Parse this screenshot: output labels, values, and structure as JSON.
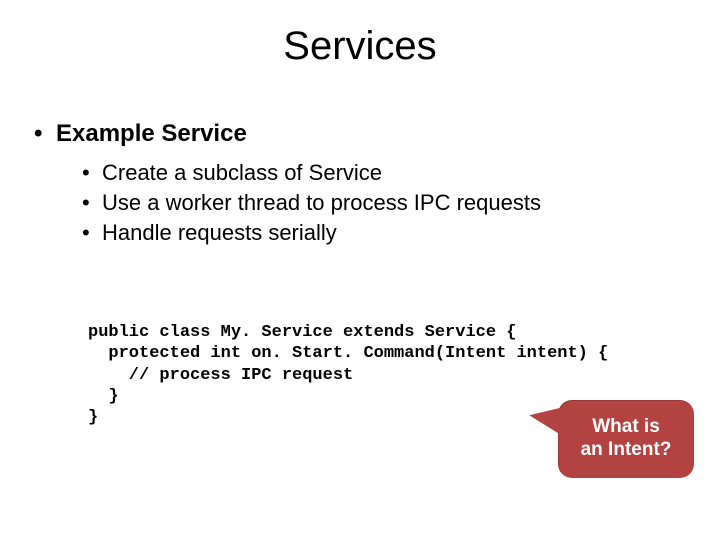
{
  "title": "Services",
  "heading": "Example Service",
  "bullets": [
    "Create a subclass of Service",
    "Use a worker thread to process IPC requests",
    "Handle requests serially"
  ],
  "code": {
    "l1": "public class My. Service extends Service {",
    "l2": "  protected int on. Start. Command(Intent intent) {",
    "l3": "    // process IPC request",
    "l4": "  }",
    "l5": "}"
  },
  "callout": {
    "line1": "What is",
    "line2": "an Intent?"
  },
  "colors": {
    "callout_bg": "#b24341"
  }
}
